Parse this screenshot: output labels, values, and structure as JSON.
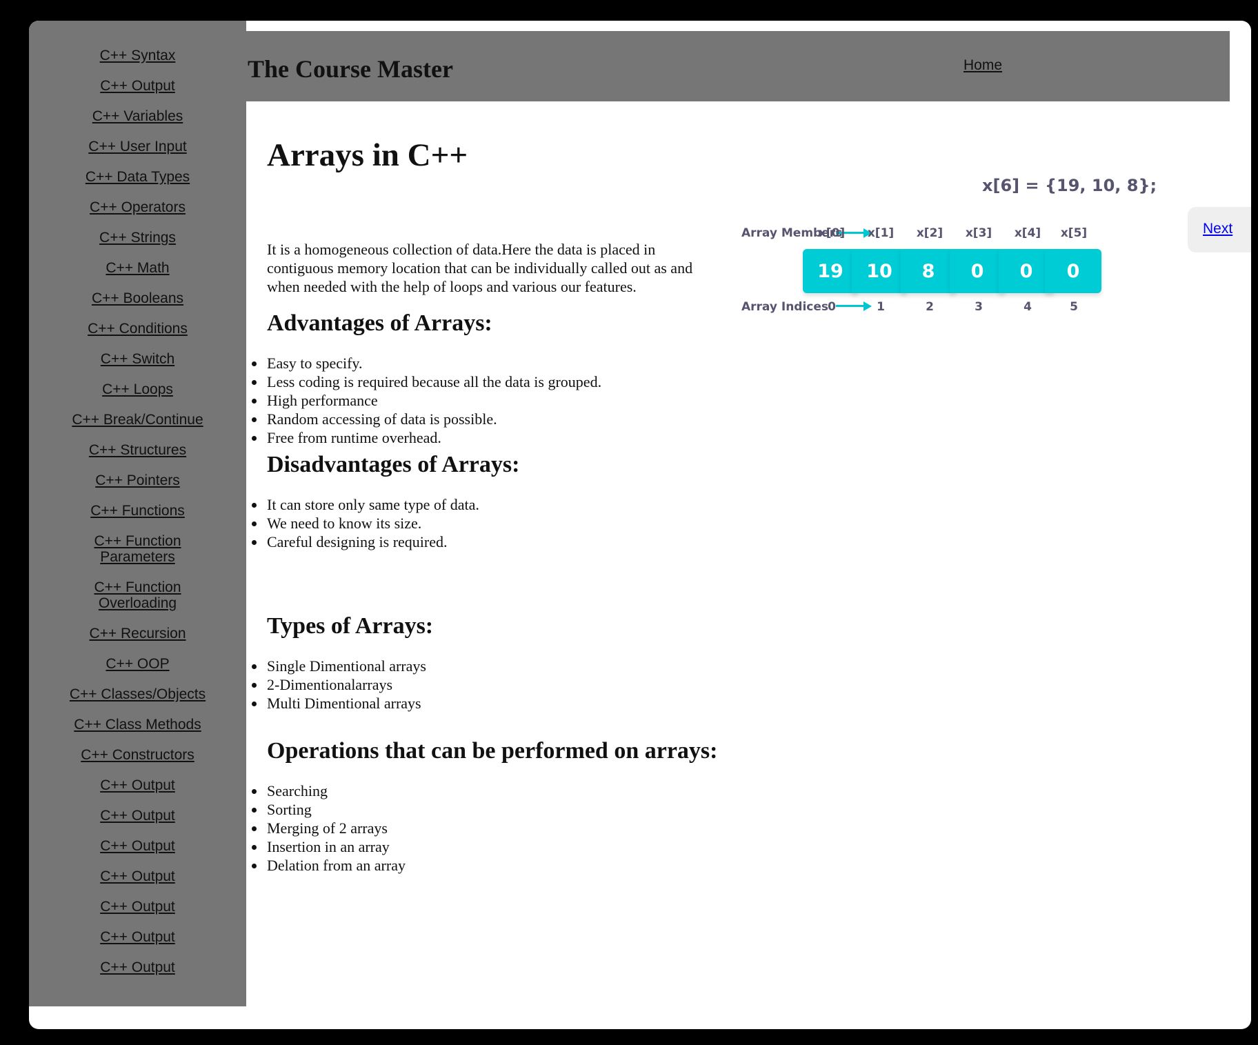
{
  "sidebar": {
    "items": [
      "C++ Syntax",
      "C++ Output",
      "C++ Variables",
      "C++ User Input",
      "C++ Data Types",
      "C++ Operators",
      "C++ Strings",
      "C++ Math",
      "C++ Booleans",
      "C++ Conditions",
      "C++ Switch",
      "C++ Loops",
      "C++ Break/Continue",
      "C++ Structures",
      "C++ Pointers",
      "C++ Functions",
      "C++ Function Parameters",
      "C++ Function Overloading",
      "C++ Recursion",
      "C++ OOP",
      "C++ Classes/Objects",
      "C++ Class Methods",
      "C++ Constructors",
      "C++ Output",
      "C++ Output",
      "C++ Output",
      "C++ Output",
      "C++ Output",
      "C++ Output",
      "C++ Output"
    ]
  },
  "header": {
    "site_title": "The Course Master",
    "home_link": "Home"
  },
  "main": {
    "title": "Arrays in C++",
    "intro": "It is a homogeneous collection of data.Here the data is placed in contiguous memory location that can be individually called out as and when needed with the help of loops and various our features.",
    "advantages": {
      "heading": "Advantages of Arrays:",
      "items": [
        "Easy to specify.",
        "Less coding is required because all the data is grouped.",
        "High performance",
        "Random accessing of data is possible.",
        "Free from runtime overhead."
      ]
    },
    "disadvantages": {
      "heading": "Disadvantages of Arrays:",
      "items": [
        "It can store only same type of data.",
        "We need to know its size.",
        "Careful designing is required."
      ]
    },
    "types": {
      "heading": "Types of Arrays:",
      "items": [
        "Single Dimentional arrays",
        "2-Dimentionalarrays",
        "Multi Dimentional arrays"
      ]
    },
    "operations": {
      "heading": "Operations that can be performed on arrays:",
      "items": [
        "Searching",
        "Sorting",
        "Merging of 2 arrays",
        "Insertion in an array",
        "Delation from an array"
      ]
    }
  },
  "diagram": {
    "title": "x[6] = {19, 10, 8};",
    "members_label": "Array Members",
    "indices_label": "Array Indices",
    "members": [
      "x[0]",
      "x[1]",
      "x[2]",
      "x[3]",
      "x[4]",
      "x[5]"
    ],
    "values": [
      "19",
      "10",
      "8",
      "0",
      "0",
      "0"
    ],
    "indices": [
      "0",
      "1",
      "2",
      "3",
      "4",
      "5"
    ],
    "accent_color": "#00ccd6"
  },
  "nav": {
    "next_label": "Next"
  }
}
